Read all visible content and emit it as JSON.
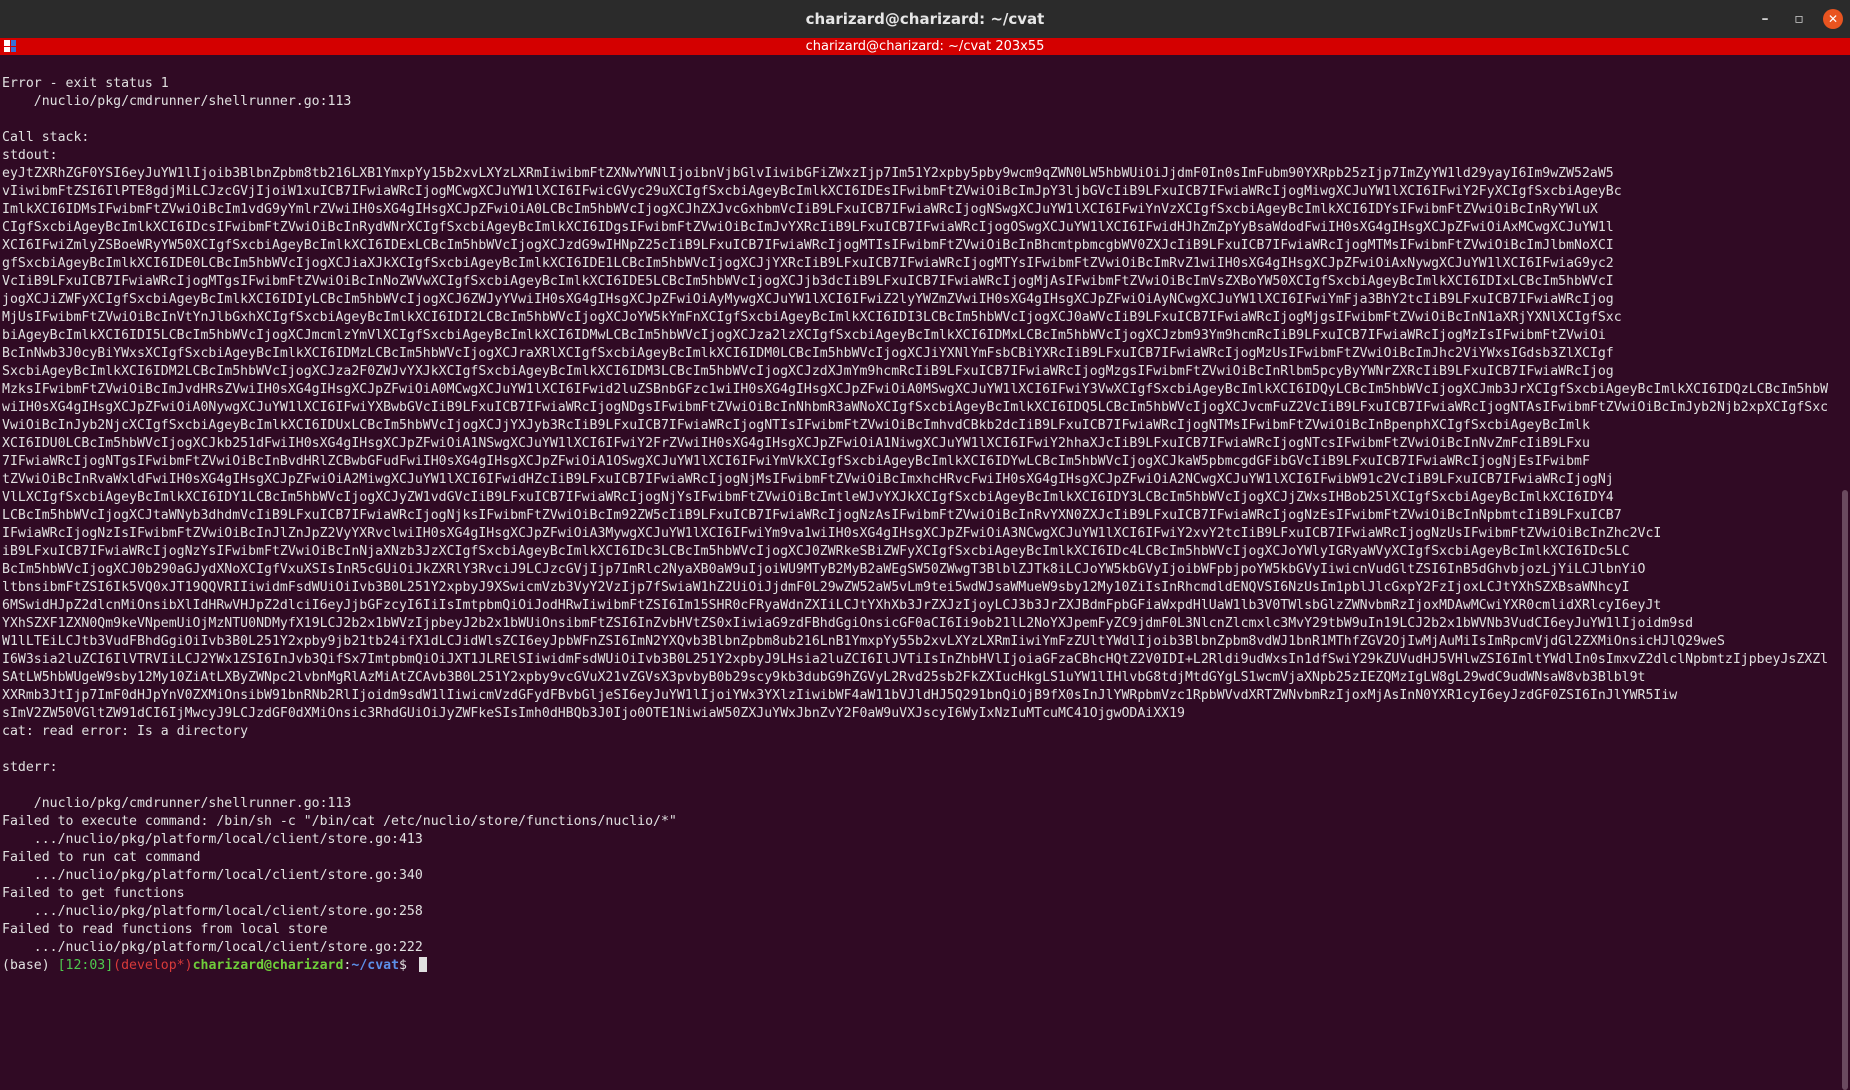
{
  "window": {
    "title": "charizard@charizard: ~/cvat",
    "minimize": "–",
    "maximize": "▫",
    "close": "✕"
  },
  "tmux": {
    "status": "charizard@charizard: ~/cvat 203x55"
  },
  "terminal": {
    "lines_top": [
      "Error - exit status 1",
      "    /nuclio/pkg/cmdrunner/shellrunner.go:113",
      "",
      "Call stack:",
      "stdout:"
    ],
    "stdout_lines": [
      "eyJtZXRhZGF0YSI6eyJuYW1lIjoib3BlbnZpbm8tb216LXB1YmxpYy15b2xvLXYzLXRmIiwibmFtZXNwYWNlIjoibnVjbGlvIiwibGFiZWxzIjp7Im51Y2xpby5pby9wcm9qZWN0LW5hbWUiOiJjdmF0In0sImFubm90YXRpb25zIjp7ImZyYW1ld29yayI6Im9wZW52aW5",
      "vIiwibmFtZSI6IlPTE8gdjMiLCJzcGVjIjoiW1xuICB7IFwiaWRcIjogMCwgXCJuYW1lXCI6IFwicGVyc29uXCIgfSxcbiAgeyBcImlkXCI6IDEsIFwibmFtZVwiOiBcImJpY3ljbGVcIiB9LFxuICB7IFwiaWRcIjogMiwgXCJuYW1lXCI6IFwiY2FyXCIgfSxcbiAgeyBc",
      "ImlkXCI6IDMsIFwibmFtZVwiOiBcIm1vdG9yYmlrZVwiIH0sXG4gIHsgXCJpZFwiOiA0LCBcIm5hbWVcIjogXCJhZXJvcGxhbmVcIiB9LFxuICB7IFwiaWRcIjogNSwgXCJuYW1lXCI6IFwiYnVzXCIgfSxcbiAgeyBcImlkXCI6IDYsIFwibmFtZVwiOiBcInRyYWluX",
      "CIgfSxcbiAgeyBcImlkXCI6IDcsIFwibmFtZVwiOiBcInRydWNrXCIgfSxcbiAgeyBcImlkXCI6IDgsIFwibmFtZVwiOiBcImJvYXRcIiB9LFxuICB7IFwiaWRcIjogOSwgXCJuYW1lXCI6IFwidHJhZmZpYyBsaWdodFwiIH0sXG4gIHsgXCJpZFwiOiAxMCwgXCJuYW1l",
      "XCI6IFwiZmlyZSBoeWRyYW50XCIgfSxcbiAgeyBcImlkXCI6IDExLCBcIm5hbWVcIjogXCJzdG9wIHNpZ25cIiB9LFxuICB7IFwiaWRcIjogMTIsIFwibmFtZVwiOiBcInBhcmtpbmcgbWV0ZXJcIiB9LFxuICB7IFwiaWRcIjogMTMsIFwibmFtZVwiOiBcImJlbmNoXCI",
      "gfSxcbiAgeyBcImlkXCI6IDE0LCBcIm5hbWVcIjogXCJiaXJkXCIgfSxcbiAgeyBcImlkXCI6IDE1LCBcIm5hbWVcIjogXCJjYXRcIiB9LFxuICB7IFwiaWRcIjogMTYsIFwibmFtZVwiOiBcImRvZ1wiIH0sXG4gIHsgXCJpZFwiOiAxNywgXCJuYW1lXCI6IFwiaG9yc2",
      "VcIiB9LFxuICB7IFwiaWRcIjogMTgsIFwibmFtZVwiOiBcInNoZWVwXCIgfSxcbiAgeyBcImlkXCI6IDE5LCBcIm5hbWVcIjogXCJjb3dcIiB9LFxuICB7IFwiaWRcIjogMjAsIFwibmFtZVwiOiBcImVsZXBoYW50XCIgfSxcbiAgeyBcImlkXCI6IDIxLCBcIm5hbWVcI",
      "jogXCJiZWFyXCIgfSxcbiAgeyBcImlkXCI6IDIyLCBcIm5hbWVcIjogXCJ6ZWJyYVwiIH0sXG4gIHsgXCJpZFwiOiAyMywgXCJuYW1lXCI6IFwiZ2lyYWZmZVwiIH0sXG4gIHsgXCJpZFwiOiAyNCwgXCJuYW1lXCI6IFwiYmFja3BhY2tcIiB9LFxuICB7IFwiaWRcIjog",
      "MjUsIFwibmFtZVwiOiBcInVtYnJlbGxhXCIgfSxcbiAgeyBcImlkXCI6IDI2LCBcIm5hbWVcIjogXCJoYW5kYmFnXCIgfSxcbiAgeyBcImlkXCI6IDI3LCBcIm5hbWVcIjogXCJ0aWVcIiB9LFxuICB7IFwiaWRcIjogMjgsIFwibmFtZVwiOiBcInN1aXRjYXNlXCIgfSxc",
      "biAgeyBcImlkXCI6IDI5LCBcIm5hbWVcIjogXCJmcmlzYmVlXCIgfSxcbiAgeyBcImlkXCI6IDMwLCBcIm5hbWVcIjogXCJza2lzXCIgfSxcbiAgeyBcImlkXCI6IDMxLCBcIm5hbWVcIjogXCJzbm93Ym9hcmRcIiB9LFxuICB7IFwiaWRcIjogMzIsIFwibmFtZVwiOi",
      "BcInNwb3J0cyBiYWxsXCIgfSxcbiAgeyBcImlkXCI6IDMzLCBcIm5hbWVcIjogXCJraXRlXCIgfSxcbiAgeyBcImlkXCI6IDM0LCBcIm5hbWVcIjogXCJiYXNlYmFsbCBiYXRcIiB9LFxuICB7IFwiaWRcIjogMzUsIFwibmFtZVwiOiBcImJhc2ViYWxsIGdsb3ZlXCIgf",
      "SxcbiAgeyBcImlkXCI6IDM2LCBcIm5hbWVcIjogXCJza2F0ZWJvYXJkXCIgfSxcbiAgeyBcImlkXCI6IDM3LCBcIm5hbWVcIjogXCJzdXJmYm9hcmRcIiB9LFxuICB7IFwiaWRcIjogMzgsIFwibmFtZVwiOiBcInRlbm5pcyByYWNrZXRcIiB9LFxuICB7IFwiaWRcIjog",
      "MzksIFwibmFtZVwiOiBcImJvdHRsZVwiIH0sXG4gIHsgXCJpZFwiOiA0MCwgXCJuYW1lXCI6IFwid2luZSBnbGFzc1wiIH0sXG4gIHsgXCJpZFwiOiA0MSwgXCJuYW1lXCI6IFwiY3VwXCIgfSxcbiAgeyBcImlkXCI6IDQyLCBcIm5hbWVcIjogXCJmb3JrXCIgfSxcbiAgeyBcImlkXCI6IDQzLCBcIm5hbWVcIjogXCJrbmlmZVwiIH0sXG4gIHsgXCJpZFwiOiA0NCwgXCJuYW1lXCI6IFwic3Bvb25cIiB9LFxuICB7IFwiaWRcIjogNDUsIFwibmFtZVwiOiBcImJvd2xcIiB9LFxuICB7IFwiaWRcIjog",
      "wiIH0sXG4gIHsgXCJpZFwiOiA0NywgXCJuYW1lXCI6IFwiYXBwbGVcIiB9LFxuICB7IFwiaWRcIjogNDgsIFwibmFtZVwiOiBcInNhbmR3aWNoXCIgfSxcbiAgeyBcImlkXCI6IDQ5LCBcIm5hbWVcIjogXCJvcmFuZ2VcIiB9LFxuICB7IFwiaWRcIjogNTAsIFwibmFtZVwiOiBcImJyb2Njb2xpXCIgfSxcbiAgeyBcImlkXCI6IDUxLCBcIm5hbWVcIjogXCJjYXJyb3RcIiB9LFxuICB7IFwiaWRcIjogNTIsIFwibmFtZVwiOiBcImhvdCBkb2dcIiB9LFxuICB7IFwiaWRcIjog",
      "VwiOiBcInJyb2NjcXCIgfSxcbiAgeyBcImlkXCI6IDUxLCBcIm5hbWVcIjogXCJjYXJyb3RcIiB9LFxuICB7IFwiaWRcIjogNTIsIFwibmFtZVwiOiBcImhvdCBkb2dcIiB9LFxuICB7IFwiaWRcIjogNTMsIFwibmFtZVwiOiBcInBpenphXCIgfSxcbiAgeyBcImlk",
      "XCI6IDU0LCBcIm5hbWVcIjogXCJkb251dFwiIH0sXG4gIHsgXCJpZFwiOiA1NSwgXCJuYW1lXCI6IFwiY2FrZVwiIH0sXG4gIHsgXCJpZFwiOiA1NiwgXCJuYW1lXCI6IFwiY2hhaXJcIiB9LFxuICB7IFwiaWRcIjogNTcsIFwibmFtZVwiOiBcInNvZmFcIiB9LFxu",
      "7IFwiaWRcIjogNTgsIFwibmFtZVwiOiBcInBvdHRlZCBwbGFudFwiIH0sXG4gIHsgXCJpZFwiOiA1OSwgXCJuYW1lXCI6IFwiYmVkXCIgfSxcbiAgeyBcImlkXCI6IDYwLCBcIm5hbWVcIjogXCJkaW5pbmcgdGFibGVcIiB9LFxuICB7IFwiaWRcIjogNjEsIFwibmF",
      "tZVwiOiBcInRvaWxldFwiIH0sXG4gIHsgXCJpZFwiOiA2MiwgXCJuYW1lXCI6IFwidHZcIiB9LFxuICB7IFwiaWRcIjogNjMsIFwibmFtZVwiOiBcImxhcHRvcFwiIH0sXG4gIHsgXCJpZFwiOiA2NCwgXCJuYW1lXCI6IFwibW91c2VcIiB9LFxuICB7IFwiaWRcIjogNj",
      "VlLXCIgfSxcbiAgeyBcImlkXCI6IDY1LCBcIm5hbWVcIjogXCJyZW1vdGVcIiB9LFxuICB7IFwiaWRcIjogNjYsIFwibmFtZVwiOiBcImtleWJvYXJkXCIgfSxcbiAgeyBcImlkXCI6IDY3LCBcIm5hbWVcIjogXCJjZWxsIHBob25lXCIgfSxcbiAgeyBcImlkXCI6IDY4",
      "LCBcIm5hbWVcIjogXCJtaWNyb3dhdmVcIiB9LFxuICB7IFwiaWRcIjogNjksIFwibmFtZVwiOiBcIm92ZW5cIiB9LFxuICB7IFwiaWRcIjogNzAsIFwibmFtZVwiOiBcInRvYXN0ZXJcIiB9LFxuICB7IFwiaWRcIjogNzEsIFwibmFtZVwiOiBcInNpbmtcIiB9LFxuICB7",
      "IFwiaWRcIjogNzIsIFwibmFtZVwiOiBcInJlZnJpZ2VyYXRvclwiIH0sXG4gIHsgXCJpZFwiOiA3MywgXCJuYW1lXCI6IFwiYm9va1wiIH0sXG4gIHsgXCJpZFwiOiA3NCwgXCJuYW1lXCI6IFwiY2xvY2tcIiB9LFxuICB7IFwiaWRcIjogNzUsIFwibmFtZVwiOiBcInZhc2VcI",
      "iB9LFxuICB7IFwiaWRcIjogNzYsIFwibmFtZVwiOiBcInNjaXNzb3JzXCIgfSxcbiAgeyBcImlkXCI6IDc3LCBcIm5hbWVcIjogXCJ0ZWRkeSBiZWFyXCIgfSxcbiAgeyBcImlkXCI6IDc4LCBcIm5hbWVcIjogXCJoYWlyIGRyaWVyXCIgfSxcbiAgeyBcImlkXCI6IDc5LC",
      "BcIm5hbWVcIjogXCJ0b290aGJydXNoXCIgfVxuXSIsInR5cGUiOiJkZXRlY3RvciJ9LCJzcGVjIjp7ImRlc2NyaXB0aW9uIjoiWU9MTyB2MyB2aWEgSW50ZWwgT3BlblZJTk8iLCJoYW5kbGVyIjoibWFpbjpoYW5kbGVyIiwicnVudGltZSI6InB5dGhvbjozLjYiLCJlbnYiO",
      "ltbnsibmFtZSI6Ik5VQ0xJT19QQVRIIiwidmFsdWUiOiIvb3B0L251Y2xpbyJ9XSwicmVzb3VyY2VzIjp7fSwiaW1hZ2UiOiJjdmF0L29wZW52aW5vLm9tei5wdWJsaWMueW9sby12My10ZiIsInRhcmdldENQVSI6NzUsIm1pblJlcGxpY2FzIjoxLCJtYXhSZXBsaWNhcyI",
      "6MSwidHJpZ2dlcnMiOnsibXlIdHRwVHJpZ2dlciI6eyJjbGFzcyI6IiIsImtpbmQiOiJodHRwIiwibmFtZSI6Im15SHR0cFRyaWdnZXIiLCJtYXhXb3JrZXJzIjoyLCJ3b3JrZXJBdmFpbGFiaWxpdHlUaW1lb3V0TWlsbGlzZWNvbmRzIjoxMDAwMCwiYXR0cmlidXRlcyI6eyJt",
      "YXhSZXF1ZXN0Qm9keVNpemUiOjMzNTU0NDMyfX19LCJ2b2x1bWVzIjpbeyJ2b2x1bWUiOnsibmFtZSI6InZvbHVtZS0xIiwiaG9zdFBhdGgiOnsicGF0aCI6Ii9ob21lL2NoYXJpemFyZC9jdmF0L3NlcnZlcmxlc3MvY29tbW9uIn19LCJ2b2x1bWVNb3VudCI6eyJuYW1lIjoidm9sd",
      "W1lLTEiLCJtb3VudFBhdGgiOiIvb3B0L251Y2xpby9jb21tb24ifX1dLCJidWlsZCI6eyJpbWFnZSI6ImN2YXQvb3BlbnZpbm8ub216LnB1YmxpYy55b2xvLXYzLXRmIiwiYmFzZUltYWdlIjoib3BlbnZpbm8vdWJ1bnR1MThfZGV2OjIwMjAuMiIsImRpcmVjdGl2ZXMiOnsicHJlQ29weS",
      "I6W3sia2luZCI6IlVTRVIiLCJ2YWx1ZSI6InJvb3QifSx7ImtpbmQiOiJXT1JLRElSIiwidmFsdWUiOiIvb3B0L251Y2xpbyJ9LHsia2luZCI6IlJVTiIsInZhbHVlIjoiaGFzaCBhcHQtZ2V0IDI+L2Rldi9udWxsIn1dfSwiY29kZUVudHJ5VHlwZSI6ImltYWdlIn0sImxvZ2dlclNpbmtzIjpbeyJsZXZlbCI6ImRlYnVnIn1dLCJwbGF0Zm9ybSI6e30sInJlYWRpbmVzc1RpbWVvdXRTZWNvbmRzIjo2MCwiZXZlbnRUaW1lb3V0IjoiMzBzIn0sInN0YXR1cyI6eyJzdGF0ZSI6InJlYWR5IiwiaHR0cFBvcnQiOjQ5MTU0fX0=",
      "SAtLW5hbWUgeW9sby12My10ZiAtLXByZWNpc2lvbnMgRlAzMiAtZCAvb3B0L251Y2xpby9vcGVuX21vZGVsX3pvbyB0b29scy9kb3dubG9hZGVyL2Rvd25sb2FkZXIucHkgLS1uYW1lIHlvbG8tdjMtdGYgLS1wcmVjaXNpb25zIEZQMzIgLW8gL29wdC9udWNsaW8vb3Blbl9t",
      "XXRmb3JtIjp7ImF0dHJpYnV0ZXMiOnsibW91bnRNb2RlIjoidm9sdW1lIiwicmVzdGFydFBvbGljeSI6eyJuYW1lIjoiYWx3YXlzIiwibWF4aW11bVJldHJ5Q291bnQiOjB9fX0sInJlYWRpbmVzc1RpbWVvdXRTZWNvbmRzIjoxMjAsInN0YXR1cyI6eyJzdGF0ZSI6InJlYWR5Iiw",
      "sImV2ZW50VGltZW91dCI6IjMwcyJ9LCJzdGF0dXMiOnsic3RhdGUiOiJyZWFkeSIsImh0dHBQb3J0Ijo0OTE1NiwiaW50ZXJuYWxJbnZvY2F0aW9uVXJscyI6WyIxNzIuMTcuMC41OjgwODAiXX19"
    ],
    "lines_bottom": [
      "cat: read error: Is a directory",
      "",
      "stderr:",
      "",
      "    /nuclio/pkg/cmdrunner/shellrunner.go:113",
      "Failed to execute command: /bin/sh -c \"/bin/cat /etc/nuclio/store/functions/nuclio/*\"",
      "    .../nuclio/pkg/platform/local/client/store.go:413",
      "Failed to run cat command",
      "    .../nuclio/pkg/platform/local/client/store.go:340",
      "Failed to get functions",
      "    .../nuclio/pkg/platform/local/client/store.go:258",
      "Failed to read functions from local store",
      "    .../nuclio/pkg/platform/local/client/store.go:222"
    ],
    "prompt": {
      "env": "(base) ",
      "time": "[12:03]",
      "branch": "(develop*)",
      "user": "charizard@charizard",
      "sep": ":",
      "path": "~/cvat",
      "symbol": "$ "
    }
  }
}
